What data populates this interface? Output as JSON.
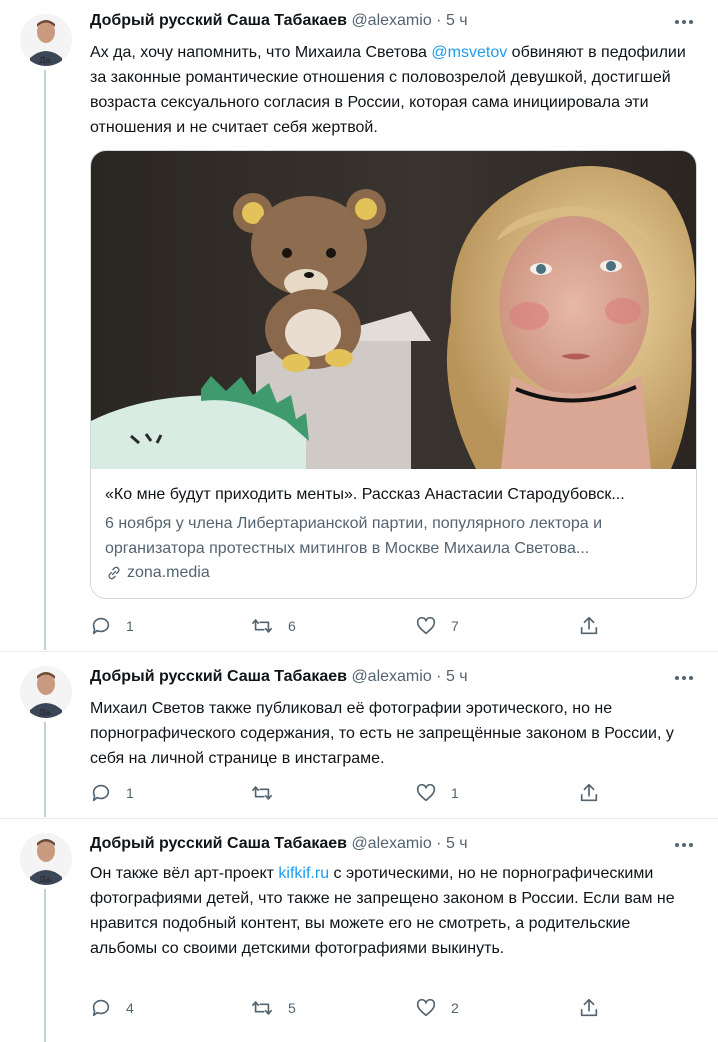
{
  "accent_color": "#1d9bf0",
  "tweets": [
    {
      "author_name": "Добрый русский Саша Табакаев",
      "handle": "@alexamio",
      "time": "· 5 ч",
      "avatar_caption": "Да.",
      "text_parts": [
        "Ах да, хочу напомнить, что Михаила Светова ",
        "@msvetov",
        " обвиняют в педофилии за законные романтические отношения с половозрелой девушкой, достигшей возраста сексуального согласия в России, которая сама инициировала эти отношения и не считает себя жертвой."
      ],
      "card": {
        "title": "«Ко мне будут приходить менты». Рассказ Анастасии Стародубовск...",
        "description": "6 ноября у члена Либертарианской партии, популярного лектора и организатора протестных митингов в Москве Михаила Светова...",
        "domain": "zona.media"
      },
      "replies": "1",
      "retweets": "6",
      "likes": "7"
    },
    {
      "author_name": "Добрый русский Саша Табакаев",
      "handle": "@alexamio",
      "time": "· 5 ч",
      "avatar_caption": "Да.",
      "text": "Михаил Светов также публиковал её фотографии эротического, но не порнографического содержания, то есть не запрещённые законом в России, у себя на личной странице в инстаграме.",
      "replies": "1",
      "retweets": "",
      "likes": "1"
    },
    {
      "author_name": "Добрый русский Саша Табакаев",
      "handle": "@alexamio",
      "time": "· 5 ч",
      "avatar_caption": "Да.",
      "text_parts": [
        "Он также вёл арт-проект ",
        "kifkif.ru",
        " с эротическими, но не порнографическими фотографиями детей, что также не запрещено законом в России. Если вам не нравится подобный контент, вы можете его не смотреть, а родительские альбомы со своими детскими фотографиями выкинуть."
      ],
      "replies": "4",
      "retweets": "5",
      "likes": "2"
    }
  ]
}
